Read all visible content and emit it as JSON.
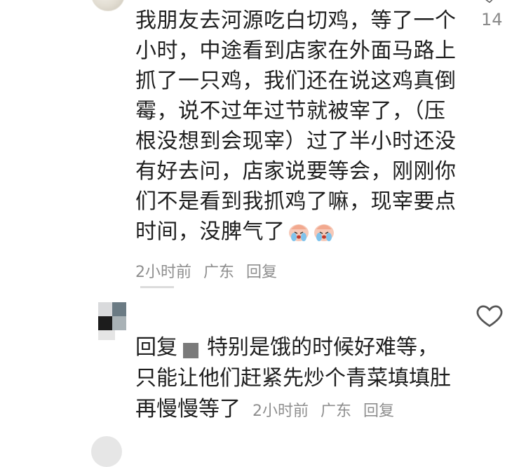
{
  "comment": {
    "likes": "14",
    "lines": [
      "我朋友去河源吃白切鸡，等了一个",
      "小时，中途看到店家在外面马路上",
      "抓了一只鸡，我们还在说这鸡真倒",
      "霉，说不过年过节就被宰了，（压",
      "根没想到会现宰）过了半小时还没",
      "有好去问，店家说要等会，刚刚你",
      "们不是看到我抓鸡了嘛，现宰要点",
      "时间，没脾气了"
    ],
    "emoji_name": "crying-face-icon",
    "time": "2小时前",
    "location": "广东",
    "reply_label": "回复"
  },
  "reply": {
    "prefix": "回复",
    "lines": [
      "特别是饿的时候好难等，",
      "只能让他们赶紧先炒个青菜填填肚",
      "再慢慢等了"
    ],
    "time": "2小时前",
    "location": "广东",
    "reply_label": "回复"
  },
  "icons": {
    "like": "heart-icon",
    "heart_color": "#555555"
  }
}
